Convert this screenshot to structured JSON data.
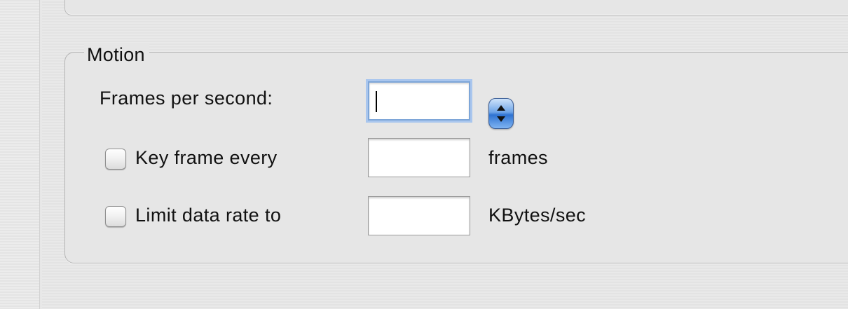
{
  "motion_group": {
    "title": "Motion",
    "frames_per_second": {
      "label": "Frames per second:",
      "value": "",
      "focused": true
    },
    "key_frame": {
      "checkbox_label": "Key frame every",
      "checked": false,
      "value": "",
      "unit": "frames"
    },
    "limit_data_rate": {
      "checkbox_label": "Limit data rate to",
      "checked": false,
      "value": "",
      "unit": "KBytes/sec"
    }
  },
  "icons": {
    "stepper": "up-down-stepper-icon"
  },
  "colors": {
    "focus_ring": "#7ea6d8",
    "stepper_blue": "#2f73d1",
    "window_gray": "#e6e6e6"
  }
}
